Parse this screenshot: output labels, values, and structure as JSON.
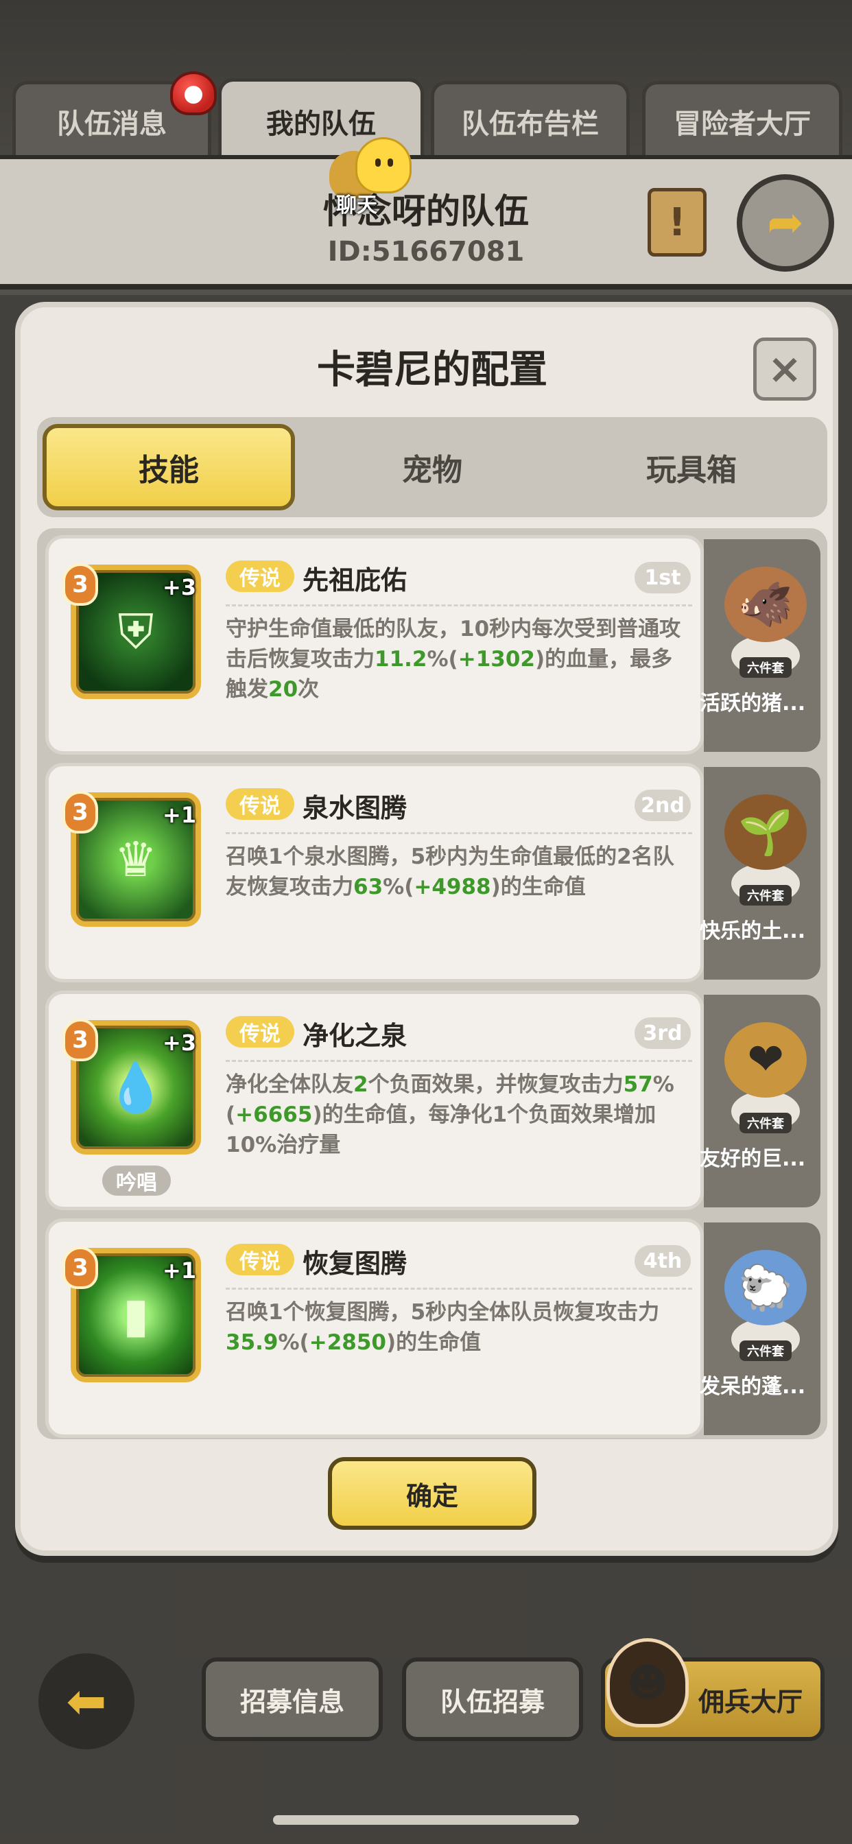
{
  "tabs": [
    "队伍消息",
    "我的队伍",
    "队伍布告栏",
    "冒险者大厅"
  ],
  "team": {
    "name": "怀念呀的队伍",
    "id": "ID:51667081",
    "chat_label": "聊天"
  },
  "dialog": {
    "title": "卡碧尼的配置",
    "segments": [
      "技能",
      "宠物",
      "玩具箱"
    ],
    "confirm_label": "确定"
  },
  "skills": [
    {
      "level": "3",
      "plus": "+3",
      "rarity": "传说",
      "name": "先祖庇佑",
      "rank": "1st",
      "desc": [
        {
          "t": "守护生命值最低的队友，10秒内每次受到普通攻击后恢复攻击力"
        },
        {
          "t": "11.2",
          "g": true
        },
        {
          "t": "%("
        },
        {
          "t": "+1302",
          "g": true
        },
        {
          "t": ")的血量，最多触发"
        },
        {
          "t": "20",
          "g": true
        },
        {
          "t": "次"
        }
      ],
      "pet": {
        "set": "六件套",
        "name": "活跃的猪..."
      }
    },
    {
      "level": "3",
      "plus": "+1",
      "rarity": "传说",
      "name": "泉水图腾",
      "rank": "2nd",
      "desc": [
        {
          "t": "召唤1个泉水图腾，5秒内为生命值最低的2名队友恢复攻击力"
        },
        {
          "t": "63",
          "g": true
        },
        {
          "t": "%("
        },
        {
          "t": "+4988",
          "g": true
        },
        {
          "t": ")的生命值"
        }
      ],
      "pet": {
        "set": "六件套",
        "name": "快乐的土..."
      }
    },
    {
      "level": "3",
      "plus": "+3",
      "rarity": "传说",
      "name": "净化之泉",
      "rank": "3rd",
      "chant": "吟唱",
      "desc": [
        {
          "t": "净化全体队友"
        },
        {
          "t": "2",
          "g": true
        },
        {
          "t": "个负面效果，并恢复攻击力"
        },
        {
          "t": "57",
          "g": true
        },
        {
          "t": "%("
        },
        {
          "t": "+6665",
          "g": true
        },
        {
          "t": ")的生命值，每净化1个负面效果增加10%治疗量"
        }
      ],
      "pet": {
        "set": "六件套",
        "name": "友好的巨..."
      }
    },
    {
      "level": "3",
      "plus": "+1",
      "rarity": "传说",
      "name": "恢复图腾",
      "rank": "4th",
      "desc": [
        {
          "t": "召唤1个恢复图腾，5秒内全体队员恢复攻击力"
        },
        {
          "t": "35.9",
          "g": true
        },
        {
          "t": "%("
        },
        {
          "t": "+2850",
          "g": true
        },
        {
          "t": ")的生命值"
        }
      ],
      "pet": {
        "set": "六件套",
        "name": "发呆的蓬..."
      }
    }
  ],
  "bottom": {
    "recruit_info": "招募信息",
    "team_recruit": "队伍招募",
    "mercenary_hall": "佣兵大厅"
  },
  "icons": [
    "bell-icon",
    "scroll-icon",
    "return-arrow-icon",
    "close-icon",
    "back-arrow-icon"
  ],
  "colors": {
    "accent_gold": "#f1cf48",
    "value_green": "#3d9a2a",
    "rarity_gold": "#f4cf4f"
  }
}
